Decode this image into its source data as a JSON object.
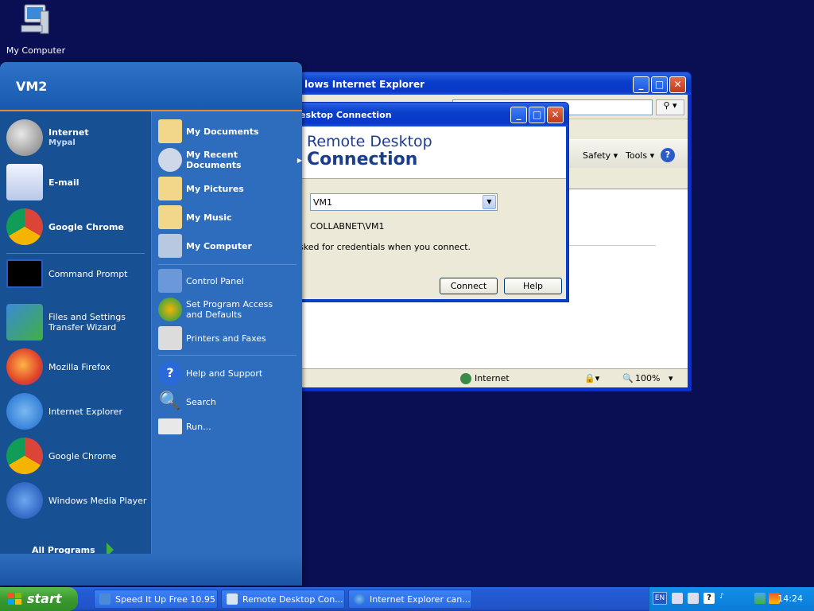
{
  "desktop": {
    "icon_label": "My Computer"
  },
  "ie": {
    "title": "lows Internet Explorer",
    "cmd_safety": "Safety ▾",
    "cmd_tools": "Tools ▾",
    "status_zone": "Internet",
    "zoom": "100%"
  },
  "rdc": {
    "title": "esktop Connection",
    "banner_line1": "Remote Desktop",
    "banner_line2": "Connection",
    "computer_value": "VM1",
    "user_label": "COLLABNET\\VM1",
    "hint": "sked for credentials when you connect.",
    "connect_label": "Connect",
    "help_label": "Help"
  },
  "start_menu": {
    "user": "VM2",
    "pinned": [
      {
        "title": "Internet",
        "sub": "Mypal"
      },
      {
        "title": "E-mail"
      },
      {
        "title": "Google Chrome"
      }
    ],
    "recent": [
      "Command Prompt",
      "Files and Settings Transfer Wizard",
      "Mozilla Firefox",
      "Internet Explorer",
      "Google Chrome",
      "Windows Media Player"
    ],
    "all_programs": "All Programs",
    "right": [
      "My Documents",
      "My Recent Documents",
      "My Pictures",
      "My Music",
      "My Computer",
      "Control Panel",
      "Set Program Access and Defaults",
      "Printers and Faxes",
      "Help and Support",
      "Search",
      "Run..."
    ]
  },
  "taskbar": {
    "start_label": "start",
    "tasks": [
      "Speed It Up Free 10.95",
      "Remote Desktop Con...",
      "Internet Explorer can..."
    ],
    "lang": "EN",
    "clock": "14:24"
  }
}
